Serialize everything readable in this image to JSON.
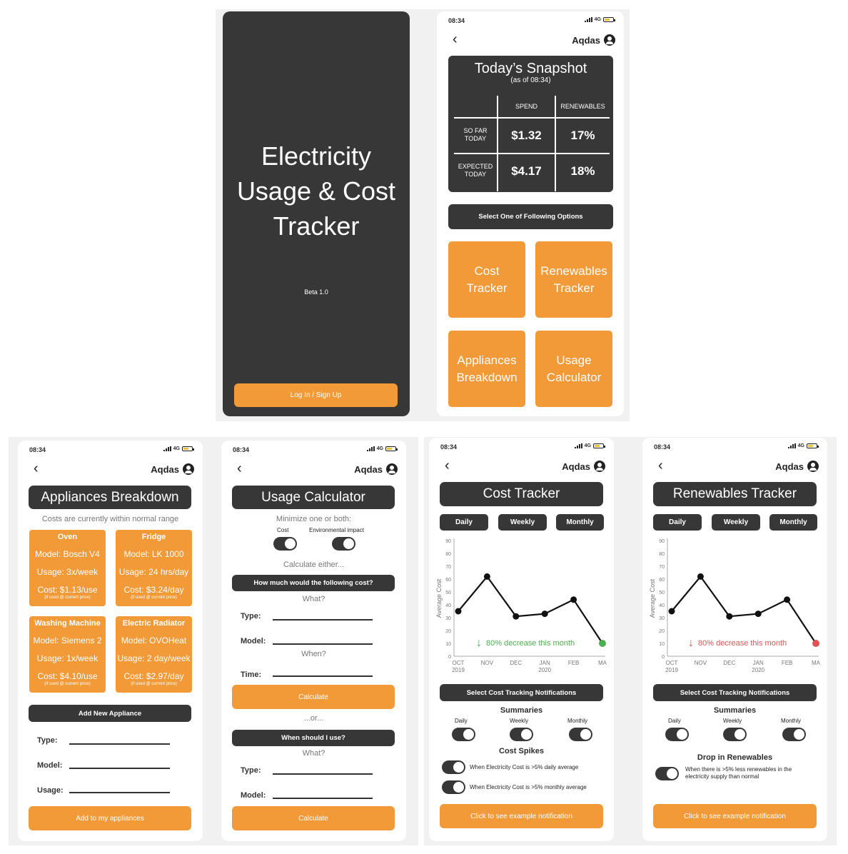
{
  "status": {
    "time": "08:34",
    "network": "4G"
  },
  "user": {
    "name": "Aqdas"
  },
  "splash": {
    "title_line1": "Electricity",
    "title_line2": "Usage & Cost",
    "title_line3": "Tracker",
    "version": "Beta 1.0",
    "login_label": "Log In / Sign Up"
  },
  "home": {
    "title": "Today’s Snapshot",
    "subtitle": "(as of 08:34)",
    "col_spend": "SPEND",
    "col_renewables": "RENEWABLES",
    "row1_label1": "SO FAR",
    "row1_label2": "TODAY",
    "row1_spend": "$1.32",
    "row1_renew": "17%",
    "row2_label1": "EXPECTED",
    "row2_label2": "TODAY",
    "row2_spend": "$4.17",
    "row2_renew": "18%",
    "select_label": "Select One of Following Options",
    "tiles": [
      {
        "l1": "Cost",
        "l2": "Tracker"
      },
      {
        "l1": "Renewables",
        "l2": "Tracker"
      },
      {
        "l1": "Appliances",
        "l2": "Breakdown"
      },
      {
        "l1": "Usage",
        "l2": "Calculator"
      }
    ]
  },
  "appliances": {
    "title": "Appliances Breakdown",
    "note": "Costs are currently within normal range",
    "cards": [
      {
        "name": "Oven",
        "model": "Model: Bosch V4",
        "usage": "Usage: 3x/week",
        "cost": "Cost: $1.13/use",
        "fine": "(if used @ current price)"
      },
      {
        "name": "Fridge",
        "model": "Model: LK 1000",
        "usage": "Usage: 24 hrs/day",
        "cost": "Cost: $3.24/day",
        "fine": "(if used @ current price)"
      },
      {
        "name": "Washing Machine",
        "model": "Model: Siemens 2",
        "usage": "Usage: 1x/week",
        "cost": "Cost: $4.10/use",
        "fine": "(if used @ current price)"
      },
      {
        "name": "Electric Radiator",
        "model": "Model: OVOHeat",
        "usage": "Usage: 2 day/week",
        "cost": "Cost: $2.97/day",
        "fine": "(if used @ current price)"
      }
    ],
    "add_new": "Add New Appliance",
    "type_label": "Type:",
    "model_label": "Model:",
    "usage_label": "Usage:",
    "add_button": "Add to my appliances"
  },
  "calculator": {
    "title": "Usage Calculator",
    "minimize": "Minimize one or both:",
    "opt_cost": "Cost",
    "opt_env": "Environmental impact",
    "calc_either": "Calculate either...",
    "q1": "How much would the following cost?",
    "what": "What?",
    "type_label": "Type:",
    "model_label": "Model:",
    "when": "When?",
    "time_label": "Time:",
    "calculate": "Calculate",
    "or": "...or...",
    "q2": "When should I use?",
    "what2": "What?",
    "type_label2": "Type:",
    "model_label2": "Model:",
    "calculate2": "Calculate"
  },
  "cost_tracker": {
    "title": "Cost Tracker",
    "tabs": [
      "Daily",
      "Weekly",
      "Monthly"
    ],
    "ylabel": "Average Cost",
    "annotation": "80% decrease this month",
    "notif_label": "Select Cost Tracking Notifications",
    "summaries": "Summaries",
    "sum_daily": "Daily",
    "sum_weekly": "Weekly",
    "sum_monthly": "Monthly",
    "spikes": "Cost Spikes",
    "spike1": "When Electricity Cost is >5% daily average",
    "spike2": "When Electricity Cost is >5% monthly average",
    "example": "Click to see example notification"
  },
  "renew_tracker": {
    "title": "Renewables Tracker",
    "tabs": [
      "Daily",
      "Weekly",
      "Monthly"
    ],
    "ylabel": "Average Cost",
    "annotation": "80% decrease this month",
    "notif_label": "Select Cost Tracking Notifications",
    "summaries": "Summaries",
    "sum_daily": "Daily",
    "sum_weekly": "Weekly",
    "sum_monthly": "Monthly",
    "drop": "Drop in Renewables",
    "drop_text1": "When there is >5% less renewables in the",
    "drop_text2": "electricity supply than normal",
    "example": "Click to see example notification"
  },
  "colors": {
    "accent": "#f29a38",
    "dark": "#373737",
    "green": "#4caf50",
    "red": "#e05252"
  },
  "chart_data": [
    {
      "type": "line",
      "categories": [
        "OCT 2019",
        "NOV",
        "DEC",
        "JAN 2020",
        "FEB",
        "MA"
      ],
      "x_ticks": [
        "OCT",
        "NOV",
        "DEC",
        "JAN",
        "FEB",
        "MA"
      ],
      "x_sub": [
        "2019",
        "",
        "",
        "2020",
        "",
        ""
      ],
      "values": [
        35,
        62,
        31,
        33,
        44,
        10
      ],
      "ylabel": "Average Cost",
      "ylim": [
        0,
        90
      ],
      "yticks": [
        0,
        10,
        20,
        30,
        40,
        50,
        60,
        70,
        80,
        90
      ],
      "last_point_color": "#4caf50"
    },
    {
      "type": "line",
      "categories": [
        "OCT 2019",
        "NOV",
        "DEC",
        "JAN 2020",
        "FEB",
        "MA"
      ],
      "x_ticks": [
        "OCT",
        "NOV",
        "DEC",
        "JAN",
        "FEB",
        "MA"
      ],
      "x_sub": [
        "2019",
        "",
        "",
        "2020",
        "",
        ""
      ],
      "values": [
        35,
        62,
        31,
        33,
        44,
        10
      ],
      "ylabel": "Average Cost",
      "ylim": [
        0,
        90
      ],
      "yticks": [
        0,
        10,
        20,
        30,
        40,
        50,
        60,
        70,
        80,
        90
      ],
      "last_point_color": "#e05252"
    }
  ]
}
